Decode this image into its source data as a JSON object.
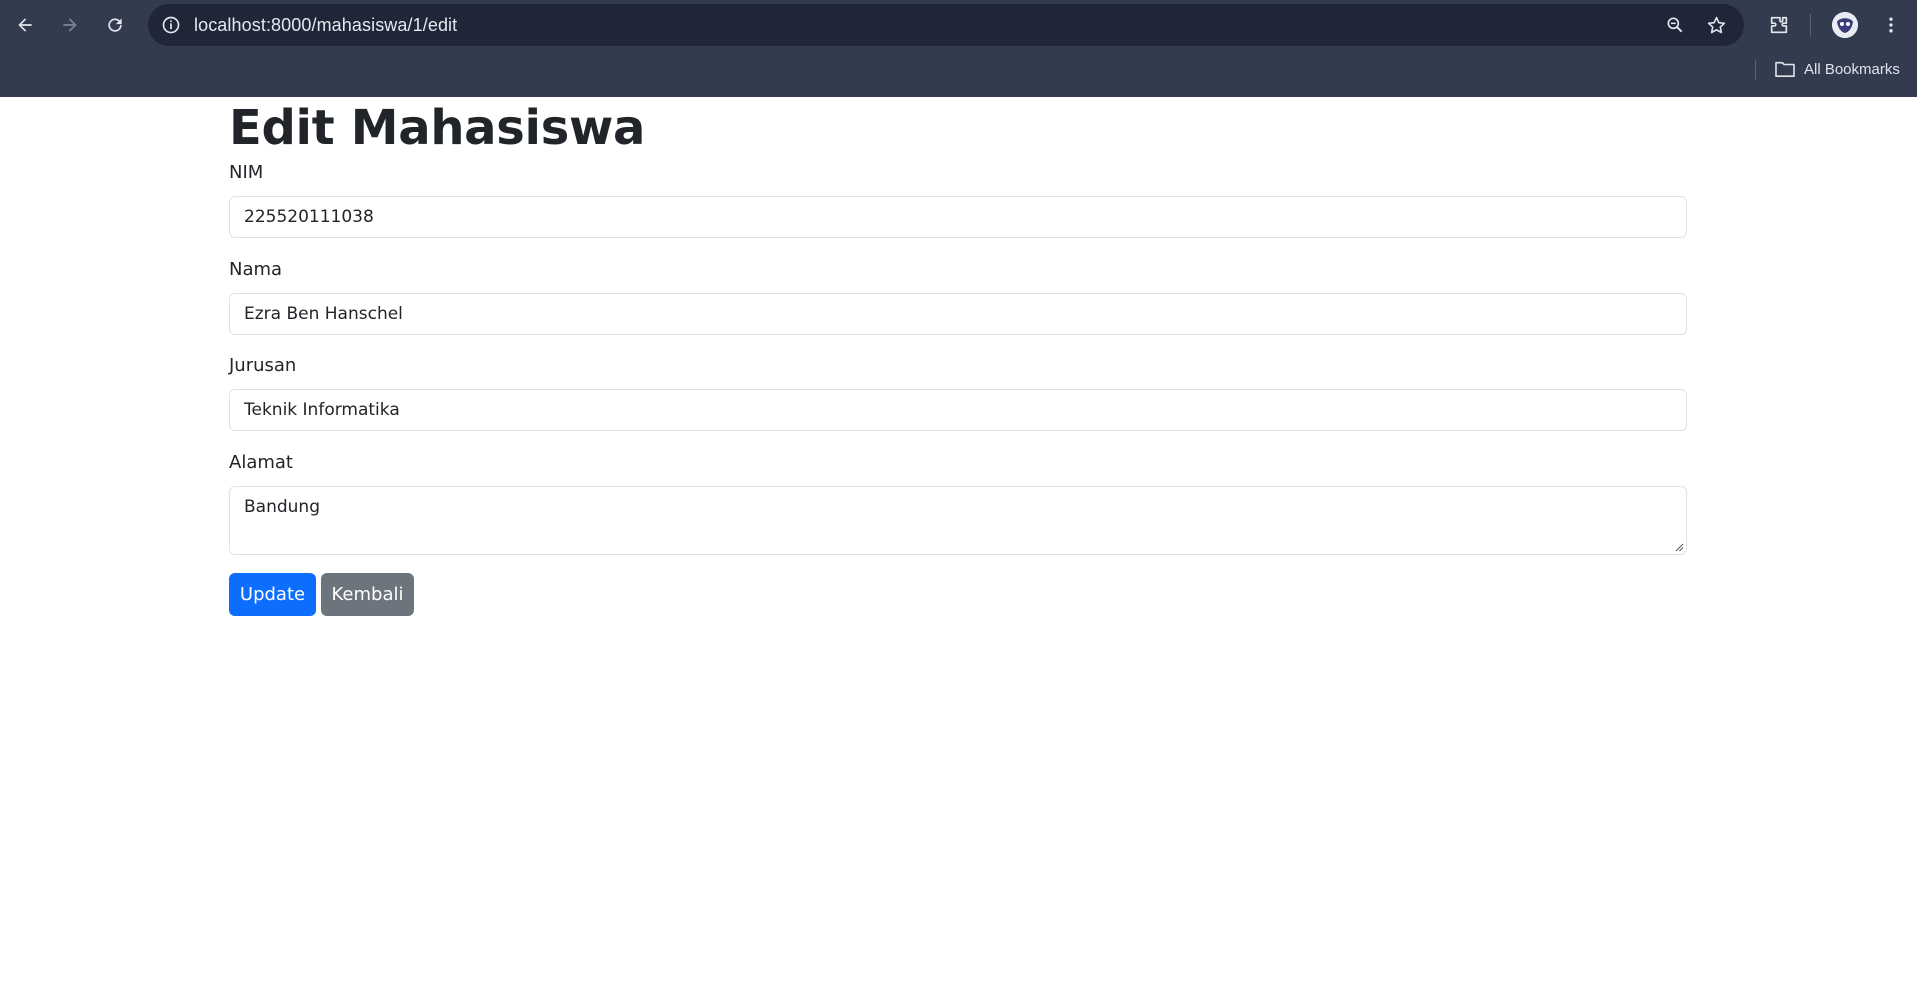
{
  "browser": {
    "url": "localhost:8000/mahasiswa/1/edit",
    "bookmarks_label": "All Bookmarks",
    "icons": [
      "back-icon",
      "forward-icon",
      "reload-icon",
      "site-info-icon",
      "zoom-icon",
      "bookmark-star-icon",
      "extensions-icon",
      "profile-avatar",
      "more-menu-icon",
      "folder-icon"
    ]
  },
  "page": {
    "title": "Edit Mahasiswa",
    "fields": [
      {
        "label": "NIM",
        "value": "225520111038"
      },
      {
        "label": "Nama",
        "value": "Ezra Ben Hanschel"
      },
      {
        "label": "Jurusan",
        "value": "Teknik Informatika"
      },
      {
        "label": "Alamat",
        "value": "Bandung"
      }
    ],
    "buttons": {
      "update": "Update",
      "back": "Kembali"
    }
  },
  "colors": {
    "chrome_bg": "#333c4e",
    "omnibox_bg": "#1f2637",
    "primary": "#0d6efd",
    "secondary": "#6c757d",
    "text": "#212529"
  }
}
